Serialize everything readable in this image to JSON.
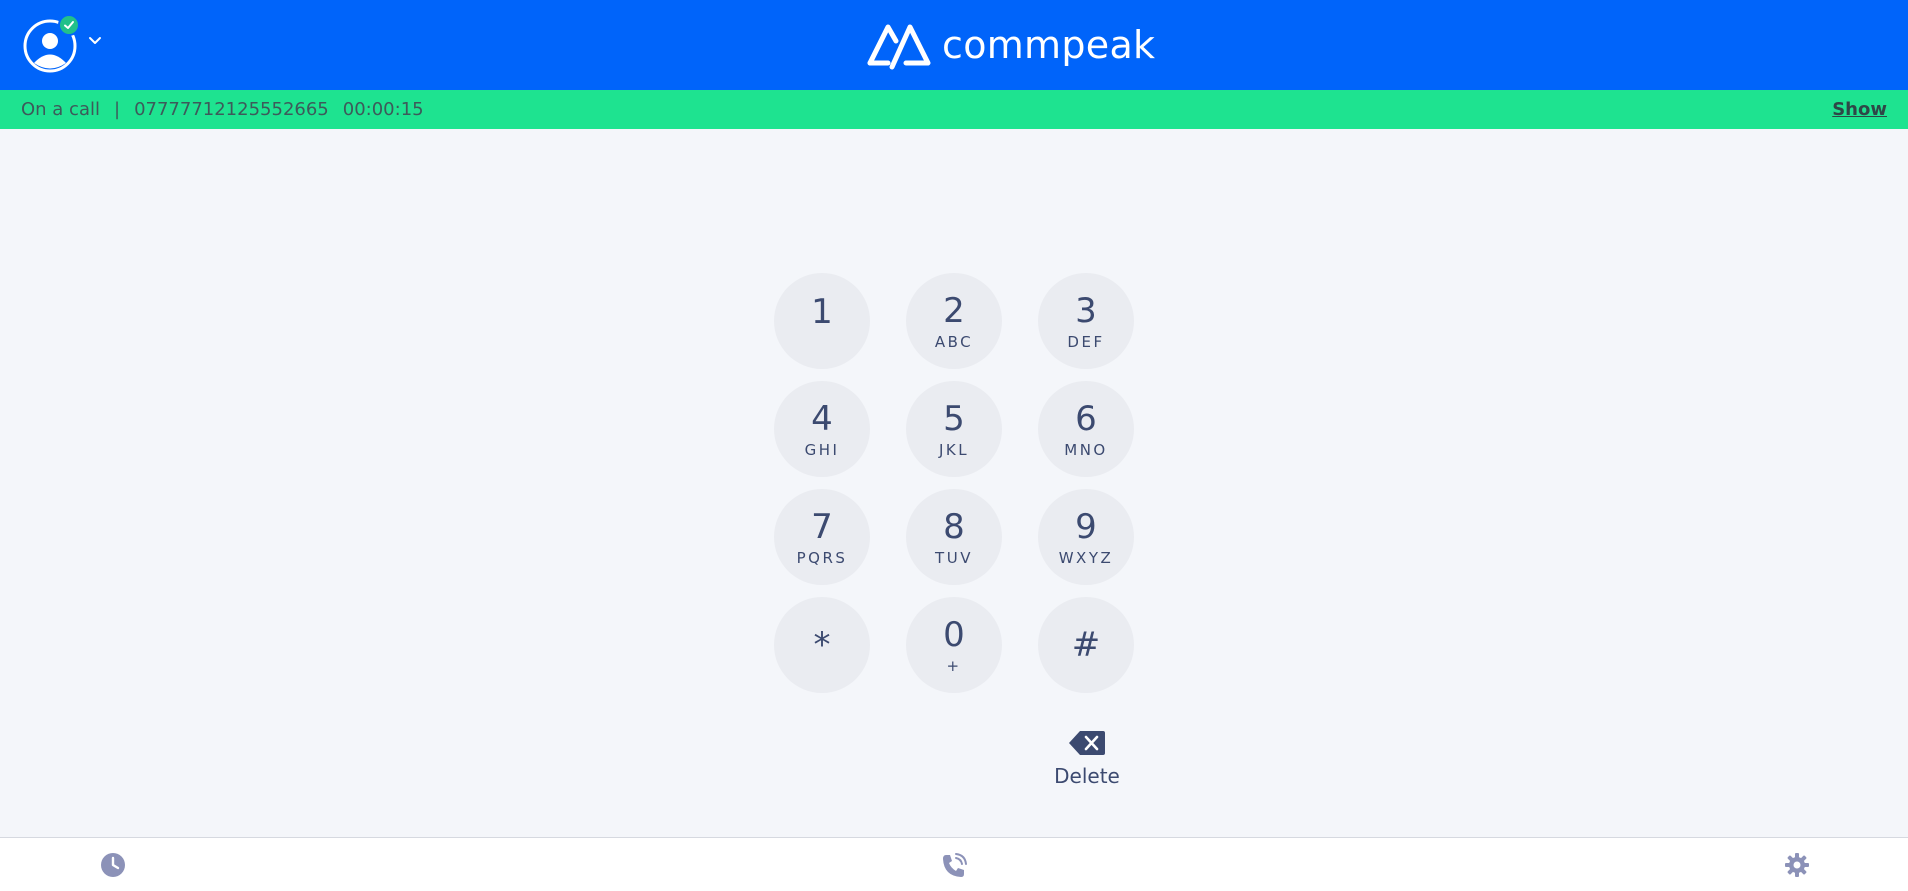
{
  "header": {
    "logo_text": "commpeak",
    "brand_color": "#0064fa",
    "avatar_icon": "user-avatar-icon",
    "status": "online",
    "status_color": "#22c08a"
  },
  "call_banner": {
    "status_text": "On a call",
    "separator": "|",
    "phone_number": "07777712125552665",
    "duration": "00:00:15",
    "show_label": "Show",
    "background_color": "#1ee390"
  },
  "dialpad": {
    "keys": [
      {
        "digit": "1",
        "letters": ""
      },
      {
        "digit": "2",
        "letters": "ABC"
      },
      {
        "digit": "3",
        "letters": "DEF"
      },
      {
        "digit": "4",
        "letters": "GHI"
      },
      {
        "digit": "5",
        "letters": "JKL"
      },
      {
        "digit": "6",
        "letters": "MNO"
      },
      {
        "digit": "7",
        "letters": "PQRS"
      },
      {
        "digit": "8",
        "letters": "TUV"
      },
      {
        "digit": "9",
        "letters": "WXYZ"
      },
      {
        "digit": "*",
        "letters": ""
      },
      {
        "digit": "0",
        "letters": "+"
      },
      {
        "digit": "#",
        "letters": ""
      }
    ],
    "delete_label": "Delete"
  },
  "bottom_nav": {
    "items": [
      {
        "name": "history",
        "icon": "clock-icon"
      },
      {
        "name": "dialer",
        "icon": "phone-ringing-icon"
      },
      {
        "name": "settings",
        "icon": "gear-icon"
      }
    ]
  }
}
